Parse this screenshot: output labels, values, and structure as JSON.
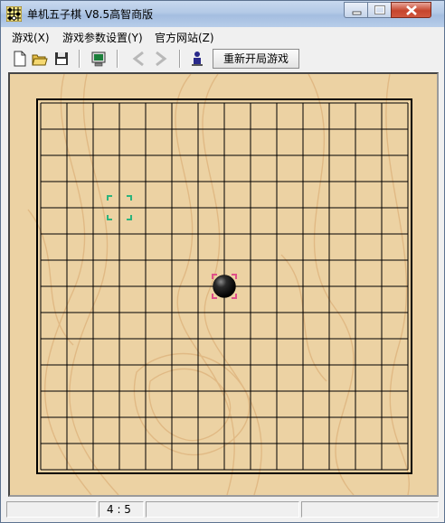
{
  "window": {
    "title": "单机五子棋 V8.5高智商版"
  },
  "menu": [
    {
      "label": "游戏(X)"
    },
    {
      "label": "游戏参数设置(Y)"
    },
    {
      "label": "官方网站(Z)"
    }
  ],
  "toolbar": {
    "new_icon": "new-document-icon",
    "open_icon": "open-folder-icon",
    "save_icon": "save-disk-icon",
    "monitor_icon": "monitor-icon",
    "undo_icon": "arrow-left-icon",
    "redo_icon": "arrow-right-icon",
    "player_icon": "player-icon",
    "restart_label": "重新开局游戏"
  },
  "board": {
    "size": 15,
    "stones": [
      {
        "col": 7,
        "row": 7,
        "color": "black"
      }
    ],
    "markers": [
      {
        "col": 3,
        "row": 4,
        "color": "#2db37c"
      },
      {
        "col": 7,
        "row": 7,
        "color": "#e0508a"
      }
    ],
    "wood_color": "#ecd2a3",
    "line_color": "#000000"
  },
  "status": {
    "coord": "4 : 5"
  }
}
